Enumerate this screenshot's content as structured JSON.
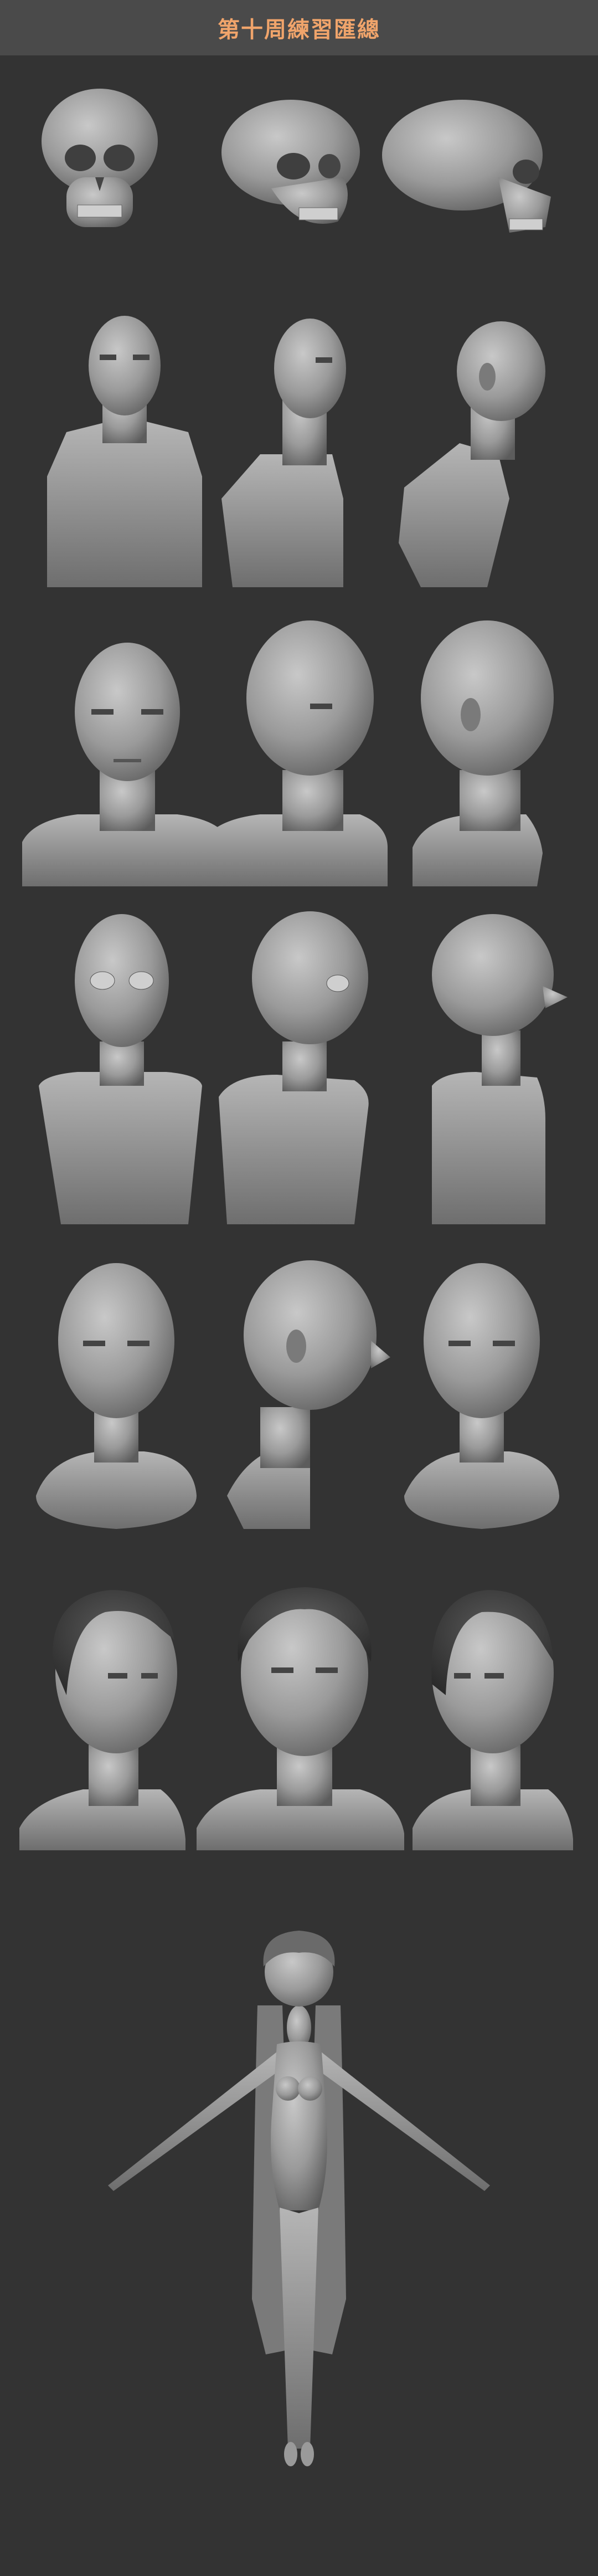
{
  "header": {
    "title": "第十周練習匯總"
  },
  "colors": {
    "background": "#333333",
    "header_bg": "#4a4a4a",
    "title": "#f0a46b",
    "clay": "#9a9a9a"
  },
  "rows": [
    {
      "id": "skull",
      "views": [
        "front",
        "three-quarter",
        "side"
      ]
    },
    {
      "id": "planar-head",
      "views": [
        "front",
        "three-quarter",
        "side"
      ]
    },
    {
      "id": "bald-bust",
      "views": [
        "front",
        "three-quarter",
        "side"
      ]
    },
    {
      "id": "stylized-bust",
      "views": [
        "front",
        "three-quarter",
        "side"
      ]
    },
    {
      "id": "anatomy-head",
      "views": [
        "front",
        "side",
        "front"
      ]
    },
    {
      "id": "head-with-hair",
      "views": [
        "three-quarter",
        "front",
        "three-quarter"
      ]
    },
    {
      "id": "female-figure",
      "views": [
        "front"
      ]
    }
  ]
}
